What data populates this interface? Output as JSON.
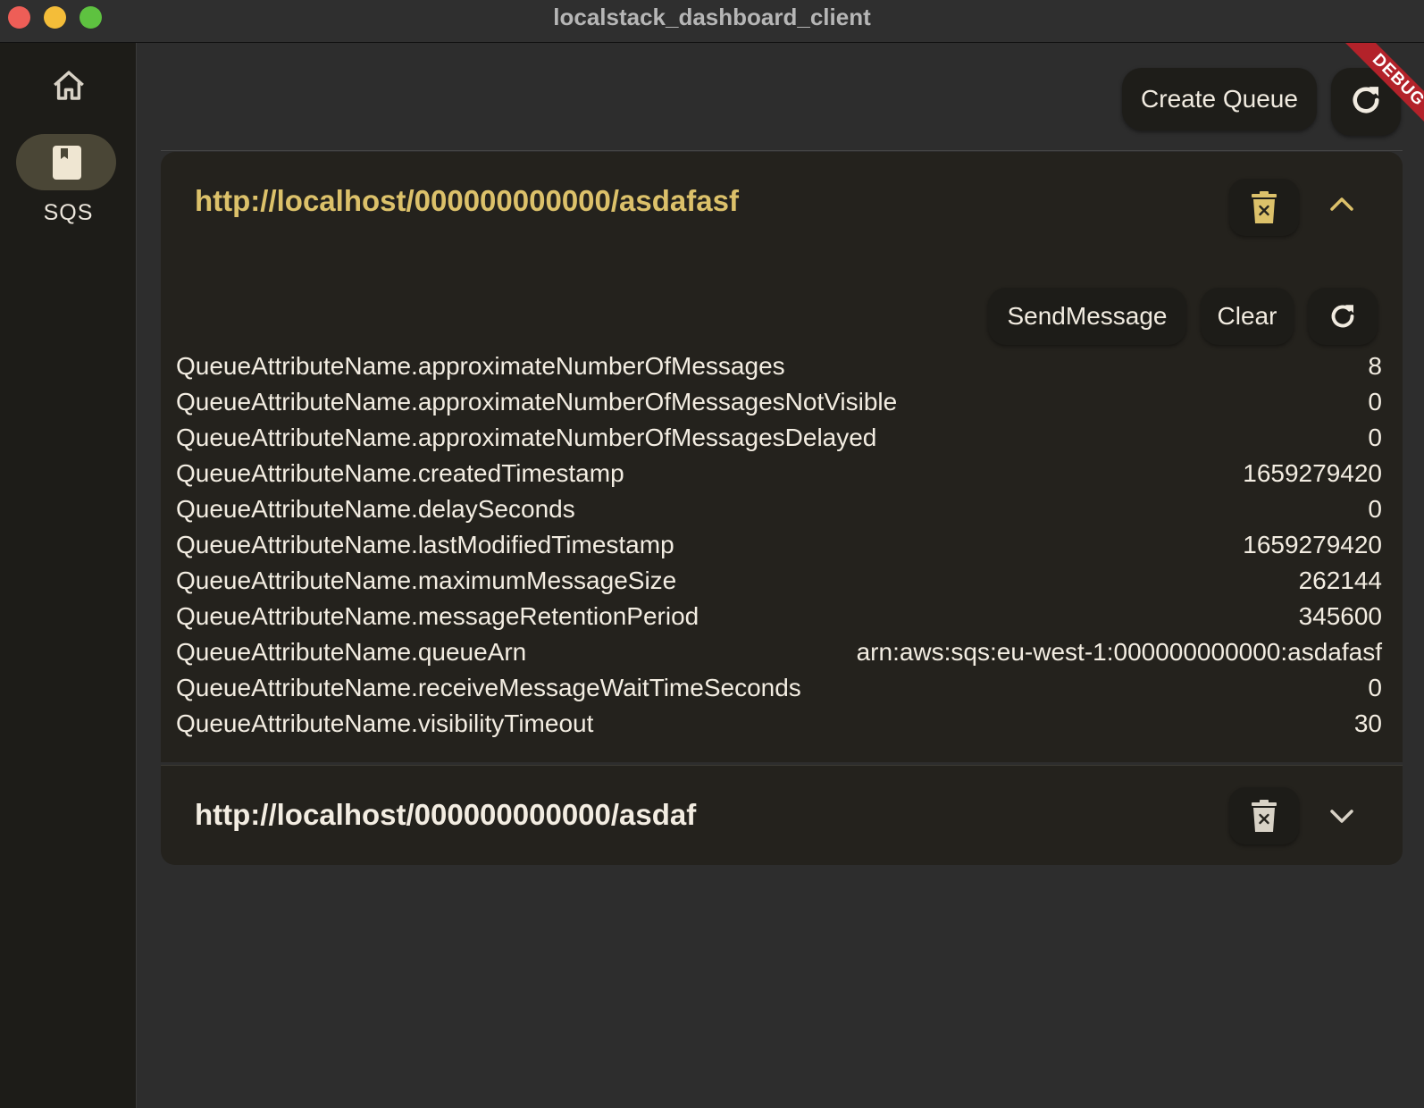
{
  "window": {
    "title": "localstack_dashboard_client"
  },
  "nav": {
    "items": [
      {
        "icon": "home-icon",
        "label": ""
      },
      {
        "icon": "sqs-icon",
        "label": "SQS",
        "selected": true
      }
    ]
  },
  "toolbar": {
    "create_queue_label": "Create Queue",
    "refresh_icon": "refresh-icon"
  },
  "debug_banner": "DEBUG",
  "queues": [
    {
      "url": "http://localhost/000000000000/asdafasf",
      "expanded": true,
      "actions": {
        "send_label": "SendMessage",
        "clear_label": "Clear"
      },
      "attributes": [
        {
          "key": "QueueAttributeName.approximateNumberOfMessages",
          "value": "8"
        },
        {
          "key": "QueueAttributeName.approximateNumberOfMessagesNotVisible",
          "value": "0"
        },
        {
          "key": "QueueAttributeName.approximateNumberOfMessagesDelayed",
          "value": "0"
        },
        {
          "key": "QueueAttributeName.createdTimestamp",
          "value": "1659279420"
        },
        {
          "key": "QueueAttributeName.delaySeconds",
          "value": "0"
        },
        {
          "key": "QueueAttributeName.lastModifiedTimestamp",
          "value": "1659279420"
        },
        {
          "key": "QueueAttributeName.maximumMessageSize",
          "value": "262144"
        },
        {
          "key": "QueueAttributeName.messageRetentionPeriod",
          "value": "345600"
        },
        {
          "key": "QueueAttributeName.queueArn",
          "value": "arn:aws:sqs:eu-west-1:000000000000:asdafasf"
        },
        {
          "key": "QueueAttributeName.receiveMessageWaitTimeSeconds",
          "value": "0"
        },
        {
          "key": "QueueAttributeName.visibilityTimeout",
          "value": "30"
        }
      ]
    },
    {
      "url": "http://localhost/000000000000/asdaf",
      "expanded": false
    }
  ],
  "colors": {
    "accent": "#dcc16a",
    "panel": "#24221d",
    "background": "#2d2d2d",
    "rail": "#1d1c18",
    "selected_pill": "#4a4636",
    "debug": "#b3222a"
  }
}
